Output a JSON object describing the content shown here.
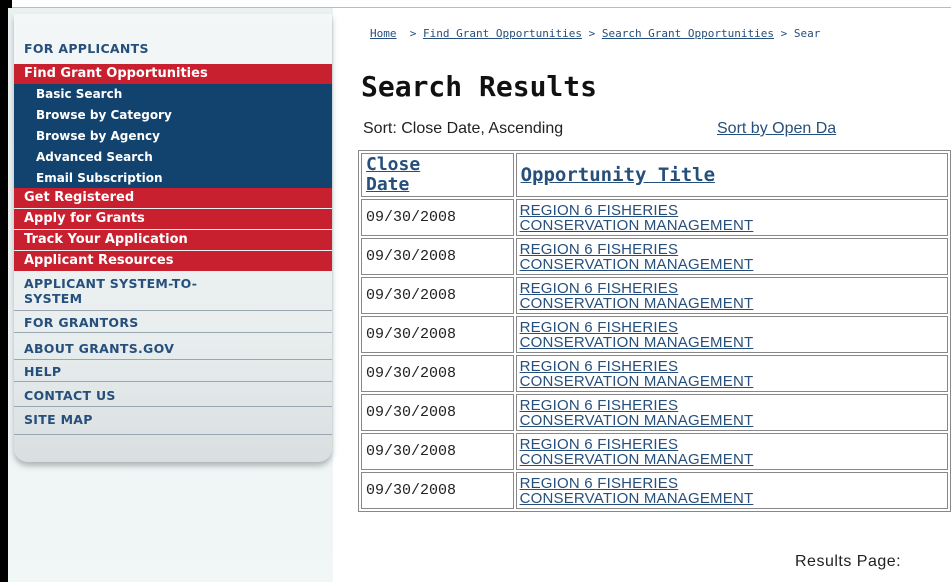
{
  "sidebar": {
    "for_applicants": "FOR APPLICANTS",
    "find_grant_opportunities": "Find Grant Opportunities",
    "sub_items": [
      {
        "label": "Basic Search"
      },
      {
        "label": "Browse by Category"
      },
      {
        "label": "Browse by Agency"
      },
      {
        "label": "Advanced Search"
      },
      {
        "label": "Email Subscription"
      }
    ],
    "red_items": [
      {
        "label": "Get Registered"
      },
      {
        "label": "Apply for Grants"
      },
      {
        "label": "Track Your Application"
      },
      {
        "label": "Applicant Resources"
      }
    ],
    "applicant_system_line1": "APPLICANT SYSTEM-TO-",
    "applicant_system_line2": "SYSTEM",
    "sections": [
      {
        "label": "FOR GRANTORS"
      },
      {
        "label": "ABOUT GRANTS.GOV"
      },
      {
        "label": "HELP"
      },
      {
        "label": "CONTACT US"
      },
      {
        "label": "SITE MAP"
      }
    ]
  },
  "breadcrumb": {
    "home": "Home",
    "sep": ">",
    "find": "Find Grant Opportunities",
    "search": "Search Grant Opportunities",
    "current": "Sear"
  },
  "page_title": "Search Results",
  "sort_label": "Sort: Close Date, Ascending",
  "sort_link": "Sort by Open Da",
  "table": {
    "col_close_line1": "Close",
    "col_close_line2": "Date",
    "col_title": "Opportunity Title",
    "rows": [
      {
        "date": "09/30/2008",
        "title_line1": "REGION 6 FISHERIES",
        "title_line2": "CONSERVATION MANAGEMENT"
      },
      {
        "date": "09/30/2008",
        "title_line1": "REGION 6 FISHERIES",
        "title_line2": "CONSERVATION MANAGEMENT"
      },
      {
        "date": "09/30/2008",
        "title_line1": "REGION 6 FISHERIES",
        "title_line2": "CONSERVATION MANAGEMENT"
      },
      {
        "date": "09/30/2008",
        "title_line1": "REGION 6 FISHERIES",
        "title_line2": "CONSERVATION MANAGEMENT"
      },
      {
        "date": "09/30/2008",
        "title_line1": "REGION 6 FISHERIES",
        "title_line2": "CONSERVATION MANAGEMENT"
      },
      {
        "date": "09/30/2008",
        "title_line1": "REGION 6 FISHERIES",
        "title_line2": "CONSERVATION MANAGEMENT"
      },
      {
        "date": "09/30/2008",
        "title_line1": "REGION 6 FISHERIES",
        "title_line2": "CONSERVATION MANAGEMENT"
      },
      {
        "date": "09/30/2008",
        "title_line1": "REGION 6 FISHERIES",
        "title_line2": "CONSERVATION MANAGEMENT"
      }
    ]
  },
  "results_page": "Results Page:",
  "colors": {
    "nav_red": "#c8202f",
    "nav_blue": "#12436f",
    "link_blue": "#264f7c"
  }
}
